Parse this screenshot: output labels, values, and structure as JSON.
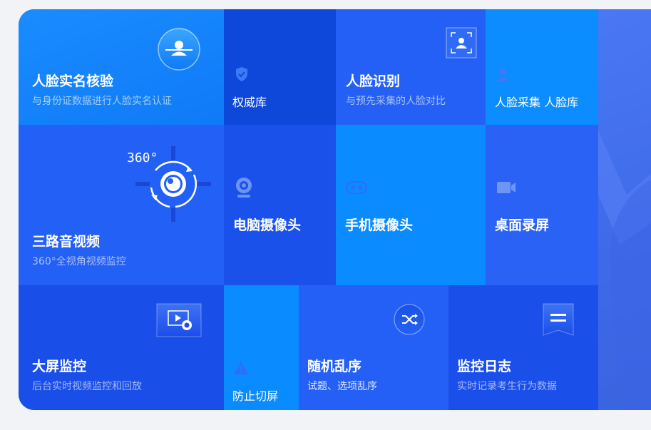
{
  "tiles": [
    {
      "id": "face-realname",
      "title": "人脸实名核验",
      "subtitle": "与身份证数据进行人脸实名认证",
      "icon": "face-verify-icon"
    },
    {
      "id": "authority-db",
      "title": "权威库",
      "icon": "shield-check-icon"
    },
    {
      "id": "face-recognition",
      "title": "人脸识别",
      "subtitle": "与预先采集的人脸对比",
      "icon": "face-scan-icon"
    },
    {
      "id": "face-collect",
      "title": "人脸采集 人脸库",
      "icon": "person-icon"
    },
    {
      "id": "three-way-av",
      "title": "三路音视频",
      "subtitle": "360°全视角视频监控",
      "icon": "camera-360-icon",
      "badge": "360°"
    },
    {
      "id": "pc-camera",
      "title": "电脑摄像头",
      "icon": "webcam-icon"
    },
    {
      "id": "phone-camera",
      "title": "手机摄像头",
      "icon": "phone-camera-icon"
    },
    {
      "id": "screen-record",
      "title": "桌面录屏",
      "icon": "video-camera-icon"
    },
    {
      "id": "big-screen",
      "title": "大屏监控",
      "subtitle": "后台实时视频监控和回放",
      "icon": "monitor-play-icon"
    },
    {
      "id": "anti-switch",
      "title": "防止切屏",
      "icon": "warning-icon"
    },
    {
      "id": "random-order",
      "title": "随机乱序",
      "subtitle": "试题、选项乱序",
      "icon": "shuffle-icon"
    },
    {
      "id": "monitor-log",
      "title": "监控日志",
      "subtitle": "实时记录考生行为数据",
      "icon": "log-document-icon"
    }
  ]
}
